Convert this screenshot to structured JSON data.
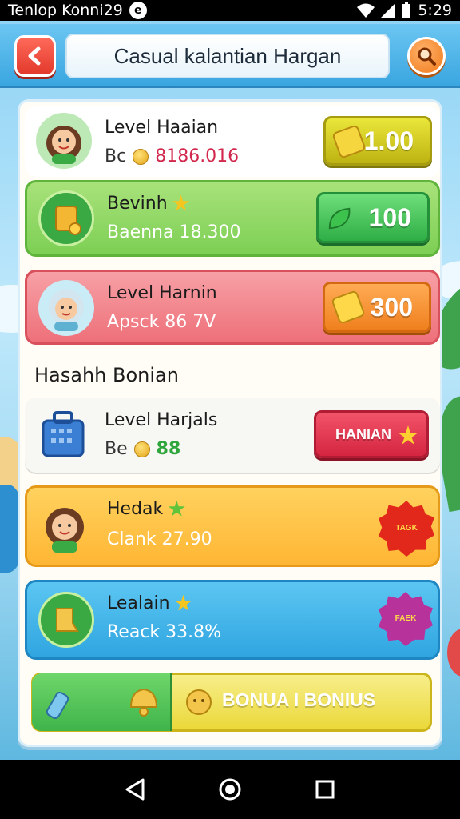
{
  "status_bar": {
    "left_text": "Tenlop Konni29",
    "time": "5:29"
  },
  "header": {
    "title": "Casual kalantian Hargan"
  },
  "rows": [
    {
      "title": "Level Haaian",
      "prefix": "Bc",
      "value": "8186.016",
      "price": "1.00"
    },
    {
      "title": "Bevinh",
      "value": "Baenna 18.300",
      "price": "100"
    },
    {
      "title": "Level Harnin",
      "value": "Apsck 86 7V",
      "price": "300"
    }
  ],
  "section_heading": "Hasahh Bonian",
  "bonus_rows": [
    {
      "title": "Level Harjals",
      "prefix": "Be",
      "value": "88",
      "button": "HANIAN"
    },
    {
      "title": "Hedak",
      "value": "Clank 27.90",
      "badge": "TAGK"
    },
    {
      "title": "Lealain",
      "value": "Reack 33.8%",
      "badge": "FAEK"
    }
  ],
  "bonus_bar": {
    "label": "BONUA I BONIUS"
  },
  "colors": {
    "green_row": "#8fdc62",
    "red_row": "#f27c84",
    "orange_row": "#ffc54a",
    "blue_row": "#4cb8ec",
    "price_yellow": "#d6d21b",
    "price_green": "#45c25a",
    "price_orange": "#f28a1e",
    "button_red": "#e33048"
  },
  "icons": [
    "back-arrow-icon",
    "search-icon",
    "coin-icon",
    "star-icon",
    "nav-back-icon",
    "nav-home-icon",
    "nav-recents-icon"
  ]
}
